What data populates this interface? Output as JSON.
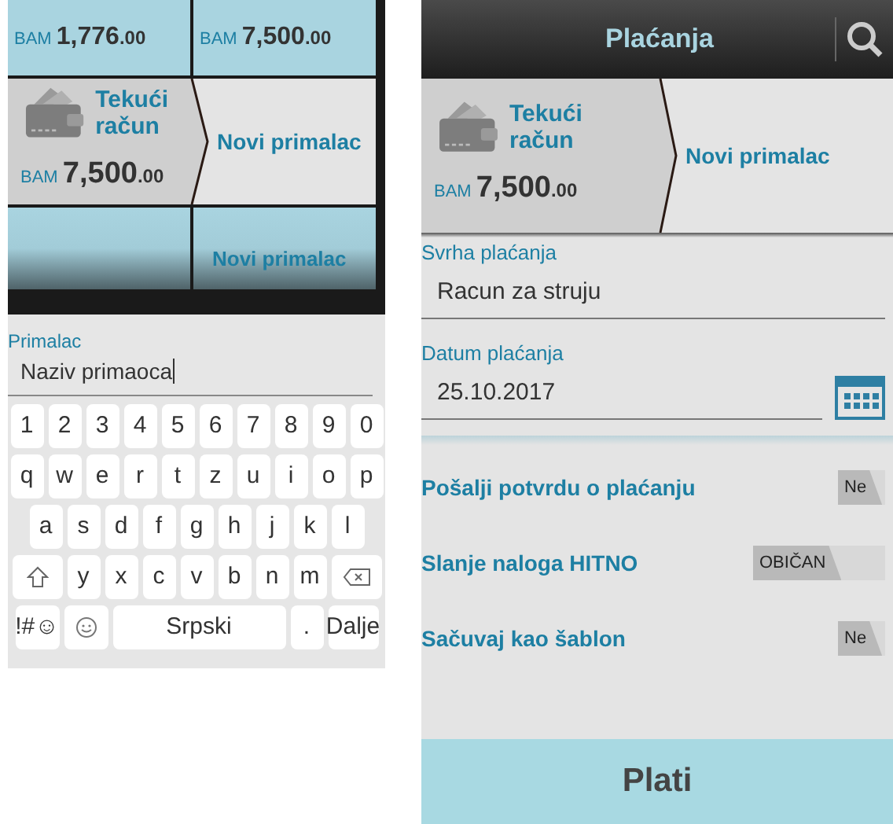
{
  "left_screen": {
    "top_cells": [
      {
        "currency": "BAM",
        "amount": "1,776",
        "decimals": ".00"
      },
      {
        "currency": "BAM",
        "amount": "7,500",
        "decimals": ".00"
      }
    ],
    "account": {
      "name": "Tekući račun",
      "currency": "BAM",
      "amount": "7,500",
      "decimals": ".00"
    },
    "recipient_tile": "Novi primalac",
    "bottom_cells": [
      {},
      {
        "label": "Novi primalac"
      }
    ],
    "recipient_field": {
      "label": "Primalac",
      "value": "Naziv primaoca"
    },
    "keyboard": [
      [
        {
          "kind": "char",
          "label": "1"
        },
        {
          "kind": "char",
          "label": "2"
        },
        {
          "kind": "char",
          "label": "3"
        },
        {
          "kind": "char",
          "label": "4"
        },
        {
          "kind": "char",
          "label": "5"
        },
        {
          "kind": "char",
          "label": "6"
        },
        {
          "kind": "char",
          "label": "7"
        },
        {
          "kind": "char",
          "label": "8"
        },
        {
          "kind": "char",
          "label": "9"
        },
        {
          "kind": "char",
          "label": "0"
        }
      ],
      [
        {
          "kind": "char",
          "label": "q"
        },
        {
          "kind": "char",
          "label": "w"
        },
        {
          "kind": "char",
          "label": "e"
        },
        {
          "kind": "char",
          "label": "r"
        },
        {
          "kind": "char",
          "label": "t"
        },
        {
          "kind": "char",
          "label": "z"
        },
        {
          "kind": "char",
          "label": "u"
        },
        {
          "kind": "char",
          "label": "i"
        },
        {
          "kind": "char",
          "label": "o"
        },
        {
          "kind": "char",
          "label": "p"
        }
      ],
      [
        {
          "kind": "char",
          "label": "a"
        },
        {
          "kind": "char",
          "label": "s"
        },
        {
          "kind": "char",
          "label": "d"
        },
        {
          "kind": "char",
          "label": "f"
        },
        {
          "kind": "char",
          "label": "g"
        },
        {
          "kind": "char",
          "label": "h"
        },
        {
          "kind": "char",
          "label": "j"
        },
        {
          "kind": "char",
          "label": "k"
        },
        {
          "kind": "char",
          "label": "l"
        }
      ],
      [
        {
          "kind": "shift"
        },
        {
          "kind": "char",
          "label": "y"
        },
        {
          "kind": "char",
          "label": "x"
        },
        {
          "kind": "char",
          "label": "c"
        },
        {
          "kind": "char",
          "label": "v"
        },
        {
          "kind": "char",
          "label": "b"
        },
        {
          "kind": "char",
          "label": "n"
        },
        {
          "kind": "char",
          "label": "m"
        },
        {
          "kind": "backspace"
        }
      ],
      [
        {
          "kind": "symbols",
          "label": "!#☺"
        },
        {
          "kind": "emoji"
        },
        {
          "kind": "space",
          "label": "Srpski"
        },
        {
          "kind": "char",
          "label": "."
        },
        {
          "kind": "action",
          "label": "Dalje"
        }
      ]
    ]
  },
  "right_screen": {
    "title": "Plaćanja",
    "account": {
      "name": "Tekući račun",
      "currency": "BAM",
      "amount": "7,500",
      "decimals": ".00"
    },
    "recipient_tile": "Novi primalac",
    "fields": [
      {
        "label": "Svrha plaćanja",
        "value": "Racun za struju",
        "kind": "text"
      },
      {
        "label": "Datum plaćanja",
        "value": "25.10.2017",
        "kind": "date"
      }
    ],
    "options": [
      {
        "label": "Pošalji potvrdu o plaćanju",
        "value": "Ne",
        "on": false
      },
      {
        "label": "Slanje naloga HITNO",
        "value": "OBIČAN",
        "on": false
      },
      {
        "label": "Sačuvaj kao šablon",
        "value": "Ne",
        "on": false
      }
    ],
    "pay_button": "Plati"
  }
}
